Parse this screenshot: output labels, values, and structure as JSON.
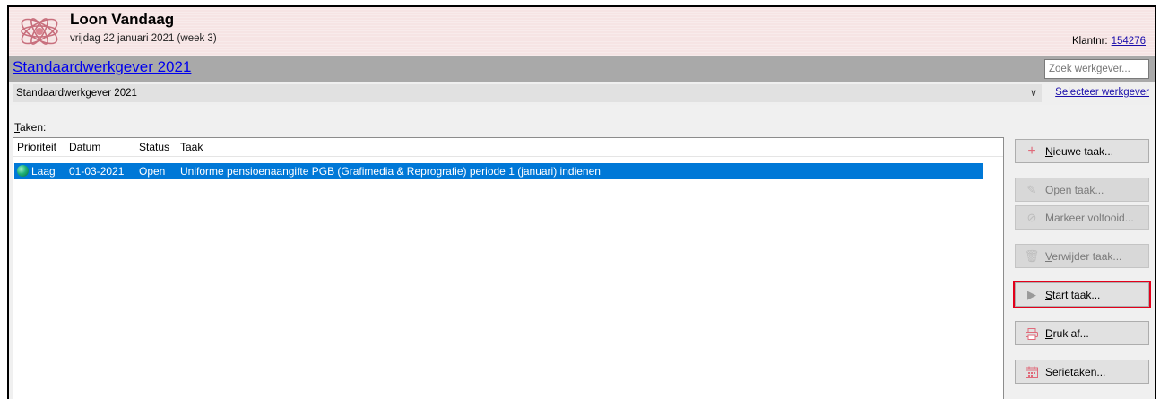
{
  "header": {
    "app_title": "Loon Vandaag",
    "date_line": "vrijdag 22 januari 2021 (week 3)",
    "klantnr_label": "Klantnr:",
    "klantnr_value": "154276"
  },
  "employer": {
    "title": "Standaardwerkgever 2021",
    "search_placeholder": "Zoek werkgever...",
    "selected": "Standaardwerkgever 2021",
    "select_link": "Selecteer werkgever"
  },
  "tasks": {
    "label": "Taken:",
    "columns": [
      "Prioriteit",
      "Datum",
      "Status",
      "Taak"
    ],
    "rows": [
      {
        "priority": "Laag",
        "date": "01-03-2021",
        "status": "Open",
        "task": "Uniforme pensioenaangifte PGB (Grafimedia & Reprografie) periode 1 (januari) indienen"
      }
    ]
  },
  "buttons": {
    "new_task": "Nieuwe taak...",
    "open_task": "Open taak...",
    "mark_done": "Markeer voltooid...",
    "delete_task": "Verwijder taak...",
    "start_task": "Start taak...",
    "print": "Druk af...",
    "series": "Serietaken..."
  },
  "colors": {
    "header_bg": "#f6e4e4",
    "employer_bar": "#a9a9a9",
    "selection": "#0078d7",
    "highlight_border": "#e3001b",
    "icon_accent": "#e06a7a"
  }
}
